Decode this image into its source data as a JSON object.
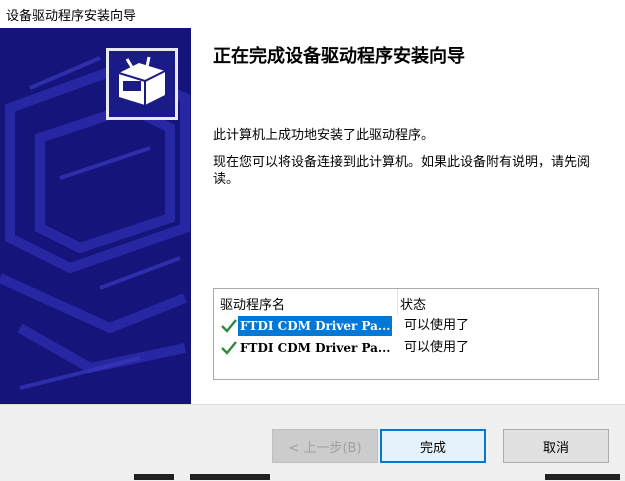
{
  "window": {
    "title": "设备驱动程序安装向导"
  },
  "content": {
    "heading": "正在完成设备驱动程序安装向导",
    "message1": "此计算机上成功地安装了此驱动程序。",
    "message2": "现在您可以将设备连接到此计算机。如果此设备附有说明，请先阅读。"
  },
  "driver_list": {
    "headers": {
      "name": "驱动程序名",
      "status": "状态"
    },
    "rows": [
      {
        "name": "FTDI CDM Driver Pa...",
        "status": "可以使用了",
        "selected": true
      },
      {
        "name": "FTDI CDM Driver Pa...",
        "status": "可以使用了",
        "selected": false
      }
    ]
  },
  "buttons": {
    "back": "< 上一步(B)",
    "finish": "完成",
    "cancel": "取消"
  },
  "colors": {
    "sidebar": "#14147a",
    "selection": "#0078d7",
    "check": "#2e8b3e"
  }
}
